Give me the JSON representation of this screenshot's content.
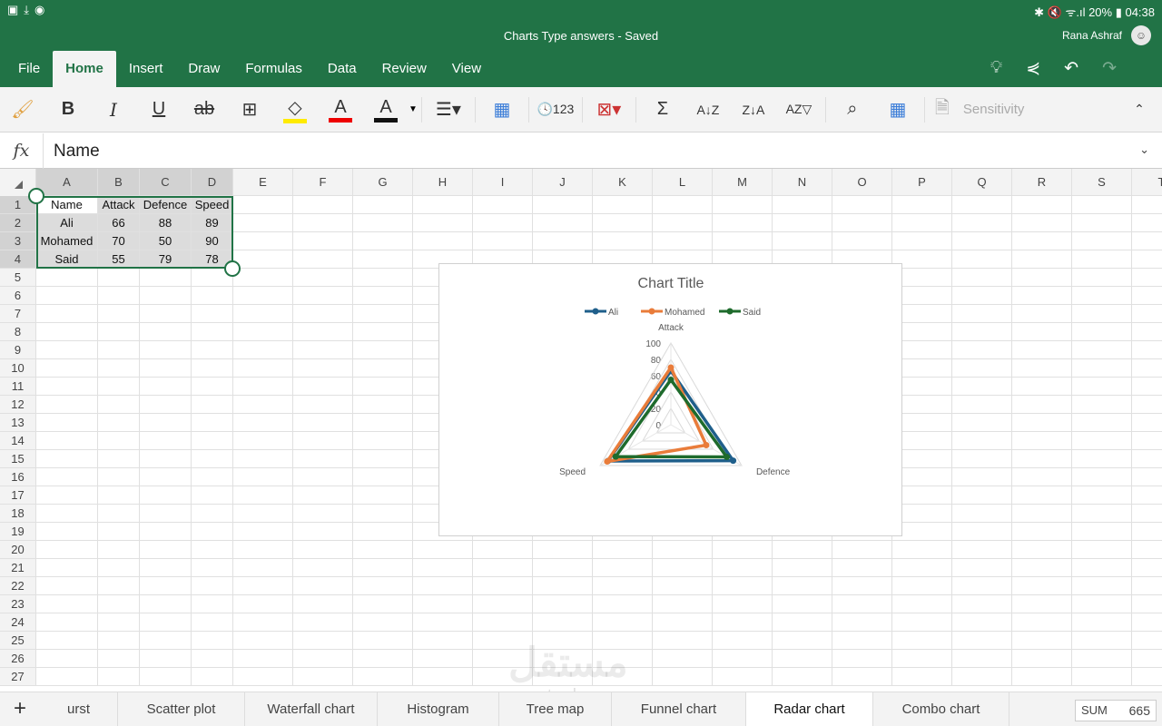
{
  "status": {
    "left_icons": [
      "gallery-icon",
      "download-icon",
      "spotify-icon"
    ],
    "right": "✱ 🔇 ᯤ.ıl 20% ▮ 04:38"
  },
  "title": "Charts Type answers - Saved",
  "user": "Rana Ashraf",
  "ribbon_tabs": [
    "File",
    "Home",
    "Insert",
    "Draw",
    "Formulas",
    "Data",
    "Review",
    "View"
  ],
  "active_tab": "Home",
  "toolbar": {
    "sensitivity": "Sensitivity"
  },
  "formula": {
    "fx": "fx",
    "value": "Name"
  },
  "columns": [
    "A",
    "B",
    "C",
    "D",
    "E",
    "F",
    "G",
    "H",
    "I",
    "J",
    "K",
    "L",
    "M",
    "N",
    "O",
    "P",
    "Q",
    "R",
    "S",
    "T"
  ],
  "rows": [
    "1",
    "2",
    "3",
    "4",
    "5",
    "6",
    "7",
    "8",
    "9",
    "10",
    "11",
    "12",
    "13",
    "14",
    "15",
    "16",
    "17",
    "18",
    "19",
    "20",
    "21",
    "22",
    "23",
    "24",
    "25",
    "26",
    "27"
  ],
  "table": [
    [
      "Name",
      "Attack",
      "Defence",
      "Speed"
    ],
    [
      "Ali",
      "66",
      "88",
      "89"
    ],
    [
      "Mohamed",
      "70",
      "50",
      "90"
    ],
    [
      "Said",
      "55",
      "79",
      "78"
    ]
  ],
  "sheets": [
    "urst",
    "Scatter plot",
    "Waterfall chart",
    "Histogram",
    "Tree map",
    "Funnel chart",
    "Radar chart",
    "Combo chart"
  ],
  "active_sheet": "Radar chart",
  "sum": {
    "label": "SUM",
    "value": "665"
  },
  "watermark": {
    "ar": "مستقل",
    "en": "mostaql.com"
  },
  "chart_data": {
    "type": "radar",
    "title": "Chart Title",
    "categories": [
      "Attack",
      "Defence",
      "Speed"
    ],
    "series": [
      {
        "name": "Ali",
        "values": [
          66,
          88,
          89
        ],
        "color": "#1f5f8b"
      },
      {
        "name": "Mohamed",
        "values": [
          70,
          50,
          90
        ],
        "color": "#e97c3a"
      },
      {
        "name": "Said",
        "values": [
          55,
          79,
          78
        ],
        "color": "#1e6b2c"
      }
    ],
    "ticks": [
      "0",
      "20",
      "40",
      "60",
      "80",
      "100"
    ],
    "range": [
      0,
      100
    ],
    "legend": "top"
  }
}
